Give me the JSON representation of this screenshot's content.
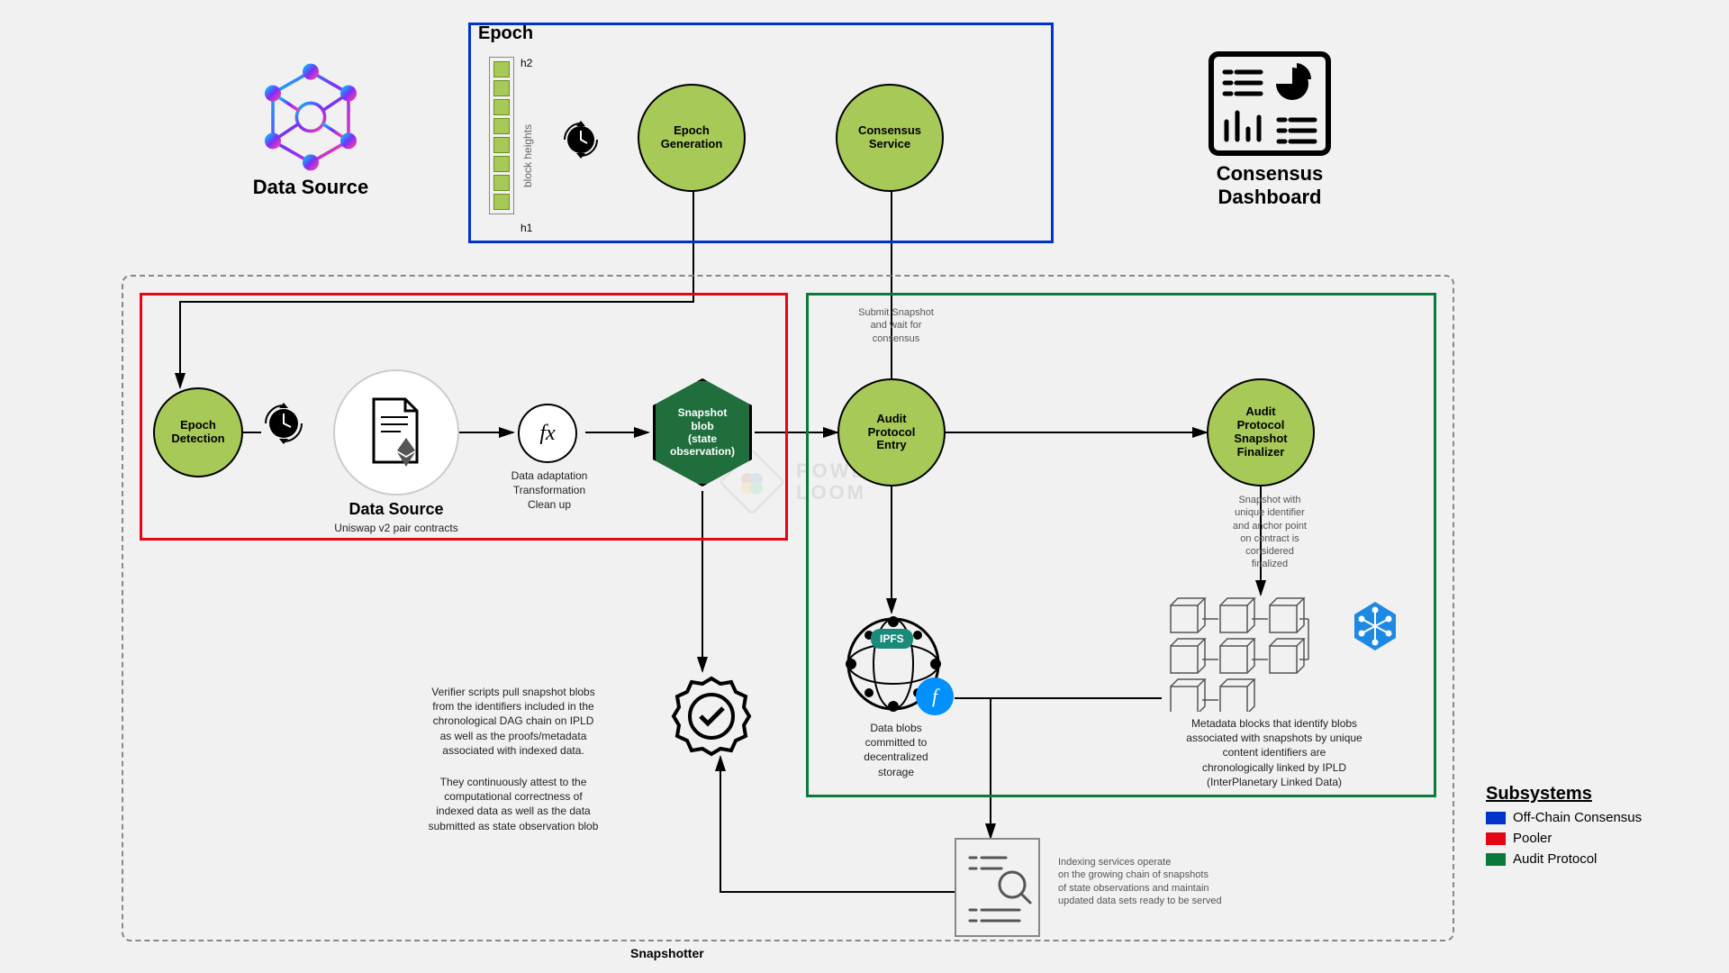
{
  "header": {
    "data_source": "Data Source",
    "consensus_dashboard_l1": "Consensus",
    "consensus_dashboard_l2": "Dashboard"
  },
  "epoch": {
    "title": "Epoch",
    "h1": "h1",
    "h2": "h2",
    "block_heights": "block heights",
    "epoch_generation": "Epoch\nGeneration",
    "consensus_service": "Consensus\nService"
  },
  "pooler": {
    "epoch_detection": "Epoch\nDetection",
    "data_source": "Data Source",
    "data_source_sub": "Uniswap v2 pair contracts",
    "fx": "fx",
    "fx_caption": "Data adaptation\nTransformation\nClean up",
    "snapshot_blob": "Snapshot\nblob\n(state\nobservation)"
  },
  "audit": {
    "submit_caption": "Submit Snapshot\nand wait for\nconsensus",
    "audit_entry": "Audit\nProtocol\nEntry",
    "finalizer": "Audit\nProtocol\nSnapshot\nFinalizer",
    "finalizer_caption": "Snapshot with\nunique identifier\nand anchor point\non contract is\nconsidered\nfinalized",
    "ipfs_caption": "Data blobs\ncommitted to\ndecentralized\nstorage",
    "metadata_caption": "Metadata blocks that identify blobs\nassociated with snapshots by unique\ncontent identifiers are\nchronologically linked by IPLD\n(InterPlanetary Linked Data)"
  },
  "verifier": {
    "text1": "Verifier scripts pull snapshot blobs\nfrom  the identifiers included in the\nchronological DAG chain on IPLD\nas well as the proofs/metadata\nassociated with indexed data.",
    "text2": "They continuously attest to the\ncomputational correctness of\nindexed data as well as the data\nsubmitted as state observation blob"
  },
  "indexer": {
    "caption": "Indexing services operate\non the growing chain of snapshots\nof state observations and maintain\nupdated data sets ready to be served"
  },
  "snapshotter_label": "Snapshotter",
  "watermark": "POWER\nLOOM",
  "legend": {
    "title": "Subsystems",
    "offchain": "Off-Chain Consensus",
    "pooler": "Pooler",
    "audit": "Audit Protocol"
  },
  "ipfs_badge": "IPFS"
}
